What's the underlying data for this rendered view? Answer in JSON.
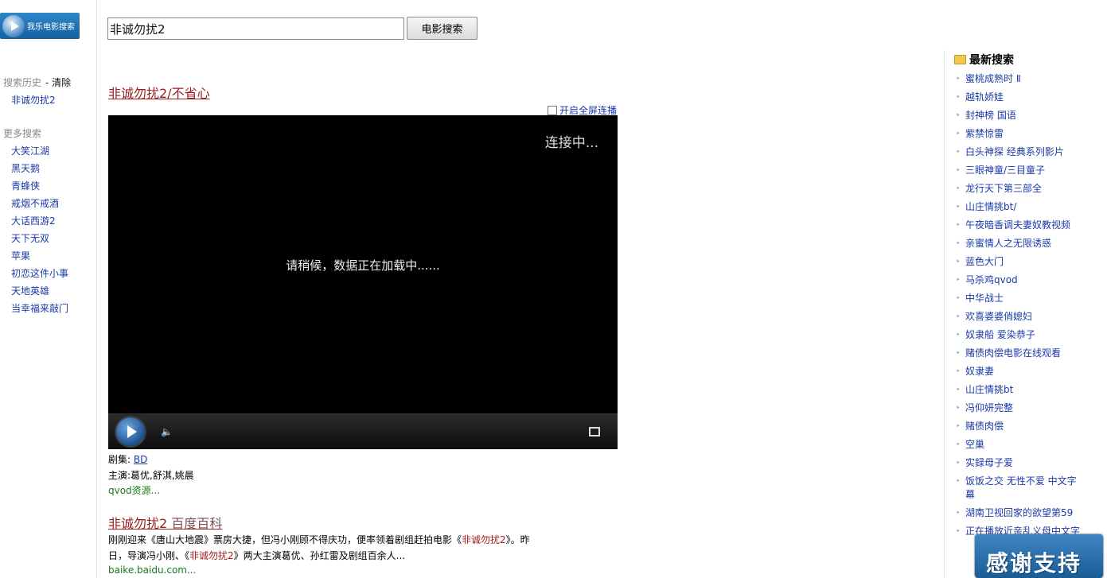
{
  "logo": {
    "text": "我乐电影搜索"
  },
  "left": {
    "history_label": "搜索历史",
    "clear_label": "- 清除",
    "history_items": [
      "非诚勿扰2"
    ],
    "more_label": "更多搜索",
    "more_items": [
      "大笑江湖",
      "黑天鹅",
      "青蜂侠",
      "戒烟不戒酒",
      "大话西游2",
      "天下无双",
      "苹果",
      "初恋这件小事",
      "天地英雄",
      "当幸福来敲门"
    ]
  },
  "search": {
    "value": "非诚勿扰2",
    "button": "电影搜索"
  },
  "result1": {
    "title": "非诚勿扰2/不省心",
    "fullscreen_label": "开启全屏连播",
    "connecting": "连接中...",
    "loading": "请稍候，数据正在加载中......",
    "episodes_label": "剧集:",
    "episodes_value": "BD",
    "cast_label": "主演:",
    "cast_value": "葛优,舒淇,姚晨",
    "source": "qvod资源..."
  },
  "result2": {
    "title_main": "非诚勿扰2",
    "title_alt": "百度百科",
    "line1_a": "刚刚迎来《唐山大地震》票房大捷，但冯小刚顾不得庆功，便率领着剧组赶拍电影《",
    "line1_hl": "非诚勿扰2",
    "line1_b": "》。昨",
    "line2_a": "日，导演冯小刚、《",
    "line2_hl": "非诚勿扰2",
    "line2_b": "》两大主演葛优、孙红雷及剧组百余人...",
    "url": "baike.baidu.com..."
  },
  "right": {
    "heading": "最新搜索",
    "items": [
      "蜜桃成熟时 Ⅱ",
      "越轨娇娃",
      "封神榜 国语",
      "紫禁惊雷",
      "白头神探 经典系列影片",
      "三眼神童/三目童子",
      "龙行天下第三部全",
      "山庄情挑bt/",
      "午夜暗香调夫妻奴教视频",
      "亲蜜情人之无限诱惑",
      "蓝色大门",
      "马杀鸡qvod",
      "中华战士",
      "欢喜婆婆俏媳妇",
      "奴隶船 爱染恭子",
      "赌债肉偿电影在线观看",
      "奴隶妻",
      "山庄情挑bt",
      "冯仰妍完整",
      "赌债肉偿",
      "空巢",
      "实録母子爱",
      "饭饭之交 无性不爱 中文字幕",
      "湖南卫视回家的欲望第59",
      "正在播放近亲乱义母中文字"
    ]
  },
  "thanks": "感谢支持"
}
